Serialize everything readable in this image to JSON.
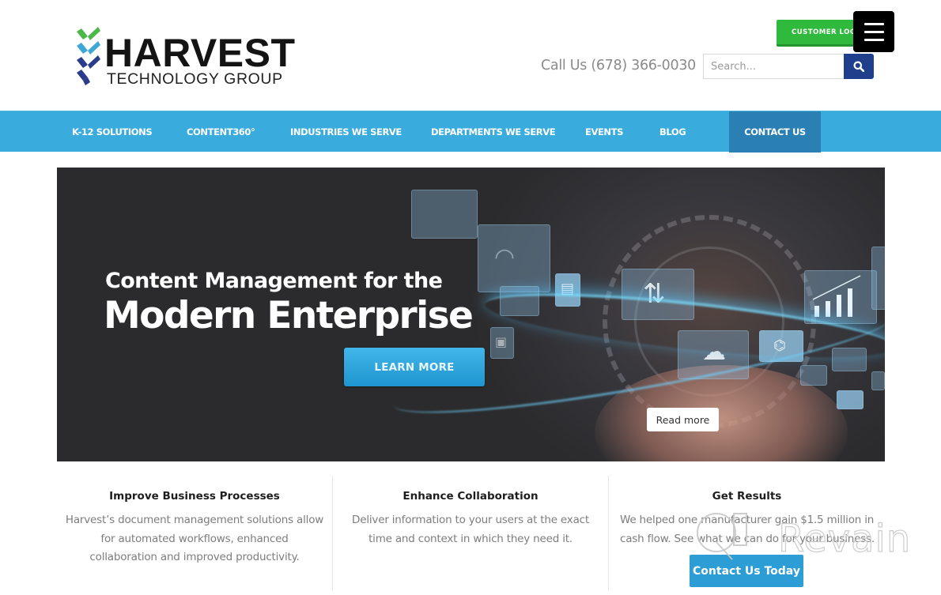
{
  "brand": {
    "name": "HARVEST",
    "subtitle": "TECHNOLOGY GROUP",
    "colors": {
      "green": "#4cb848",
      "light_blue": "#3fa7d6",
      "navy": "#2a3a8c"
    }
  },
  "header": {
    "phone_text": "Call Us (678) 366-0030",
    "search": {
      "placeholder": "Search...",
      "value": "",
      "button_icon": "search-icon"
    },
    "customer_login_label": "CUSTOMER LOGIN",
    "menu_icon": "hamburger-menu-icon"
  },
  "nav": {
    "items": [
      {
        "label": "K-12 SOLUTIONS",
        "active": false
      },
      {
        "label": "CONTENT360°",
        "active": false
      },
      {
        "label": "INDUSTRIES WE SERVE",
        "active": false
      },
      {
        "label": "DEPARTMENTS WE SERVE",
        "active": false
      },
      {
        "label": "EVENTS",
        "active": false
      },
      {
        "label": "BLOG",
        "active": false
      },
      {
        "label": "CONTACT US",
        "active": true
      }
    ],
    "colors": {
      "background": "#3aabdd",
      "active": "#2a7fb3"
    }
  },
  "hero": {
    "title_line1": "Content Management for the",
    "title_line2": "Modern Enterprise",
    "cta_label": "LEARN MORE",
    "read_more_label": "Read more",
    "icons": [
      "chart-icon",
      "wifi-icon",
      "printer-icon",
      "folder-transfer-icon",
      "cloud-server-icon",
      "network-icon",
      "bar-chart-growth-icon",
      "devices-icon"
    ]
  },
  "features": [
    {
      "title": "Improve Business Processes",
      "lines": [
        "Harvest’s document management solutions allow",
        "for automated workflows, enhanced",
        "collaboration and improved productivity."
      ]
    },
    {
      "title": "Enhance Collaboration",
      "lines": [
        "Deliver information to your users at the exact",
        "time and context in which they need it."
      ]
    },
    {
      "title": "Get Results",
      "lines": [
        "We helped one manufacturer gain $1.5 million in",
        "cash flow. See what we can do for your business."
      ],
      "button_label": "Contact Us Today"
    }
  ],
  "watermark": {
    "text": "Revain"
  }
}
